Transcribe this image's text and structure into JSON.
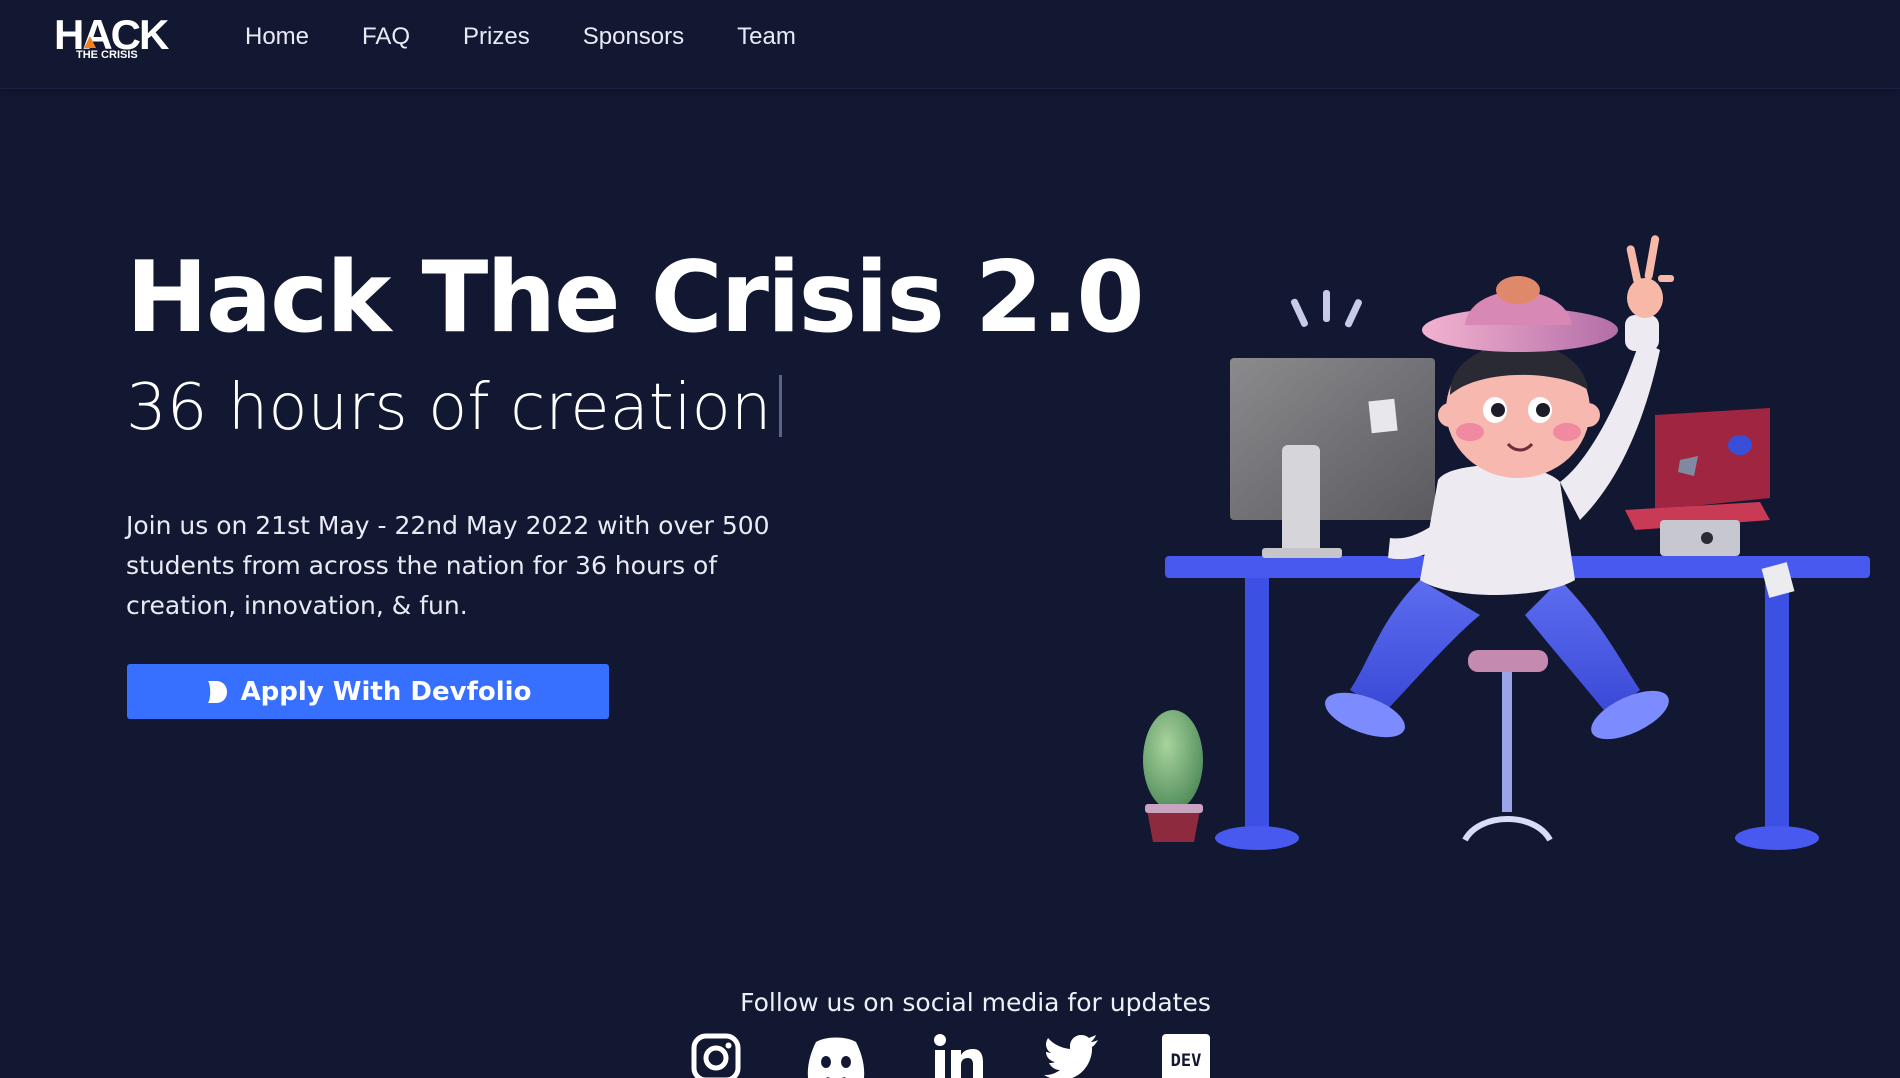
{
  "brand": {
    "logo_main": "HACK",
    "logo_sub": "THE CRISIS"
  },
  "nav": {
    "items": [
      {
        "label": "Home"
      },
      {
        "label": "FAQ"
      },
      {
        "label": "Prizes"
      },
      {
        "label": "Sponsors"
      },
      {
        "label": "Team"
      }
    ]
  },
  "hero": {
    "title": "Hack The Crisis 2.0",
    "subtitle": "36 hours of creation",
    "description": "Join us on 21st May - 22nd May 2022 with over 500 students from across the nation for 36 hours of creation, innovation, & fun.",
    "apply_label": "Apply With Devfolio"
  },
  "social": {
    "title": "Follow us on social media for updates",
    "icons": [
      "instagram-icon",
      "discord-icon",
      "linkedin-icon",
      "twitter-icon",
      "dev-icon"
    ],
    "dev_text": "DEV"
  },
  "colors": {
    "background": "#131832",
    "accent": "#3770ff",
    "flame": "#f4801f",
    "desk": "#4357ea"
  }
}
